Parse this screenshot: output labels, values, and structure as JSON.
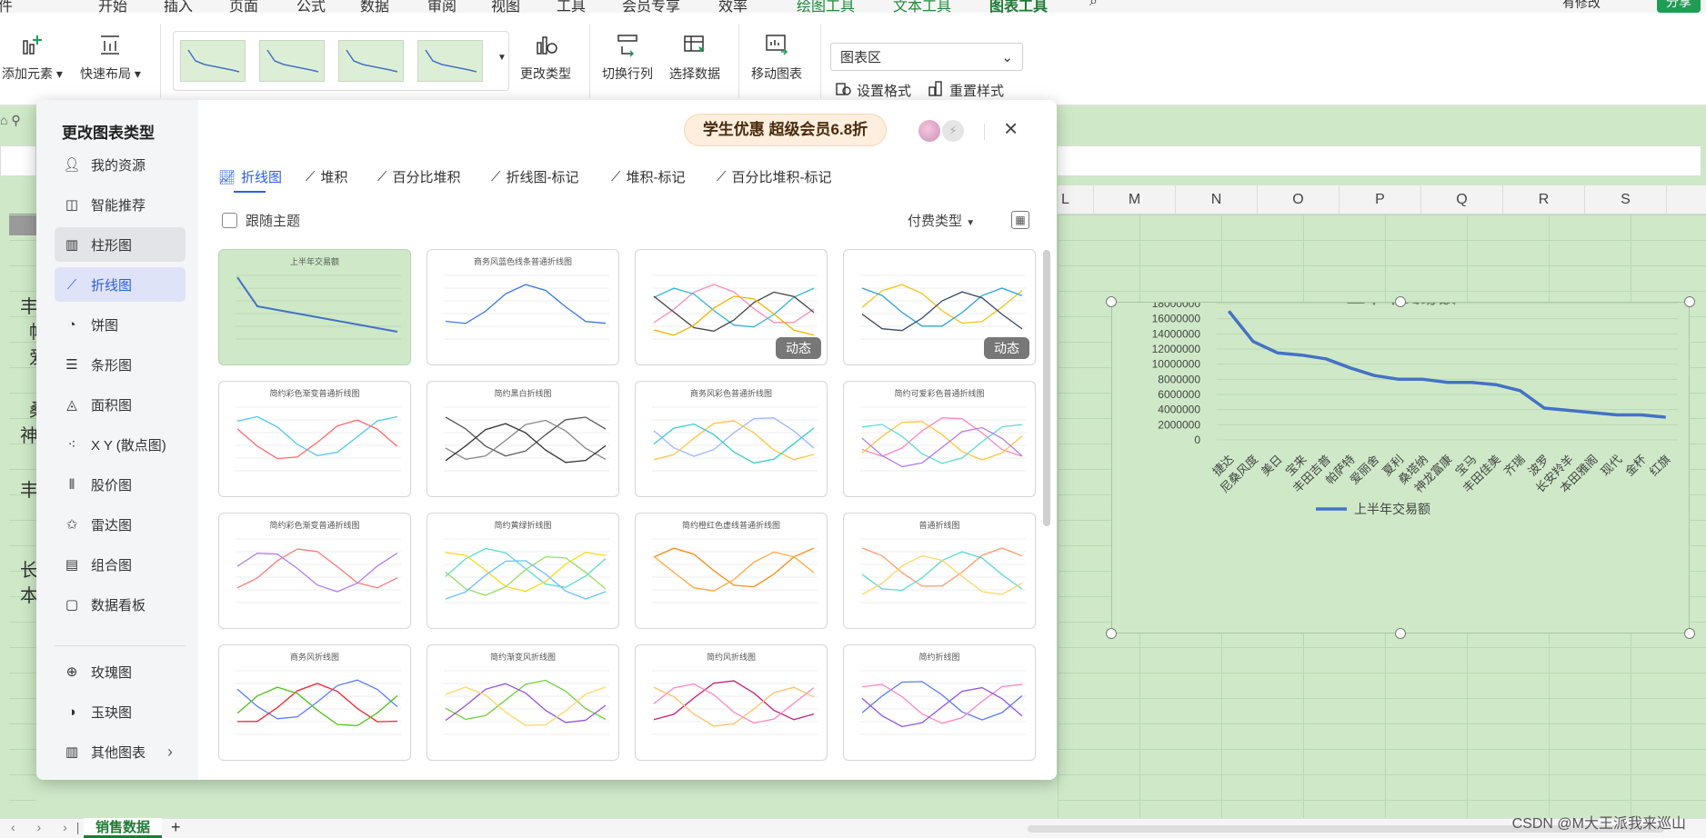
{
  "menu_tabs": [
    "文件",
    "开始",
    "插入",
    "页面",
    "公式",
    "数据",
    "审阅",
    "视图",
    "工具",
    "会员专享",
    "效率",
    "绘图工具",
    "文本工具",
    "图表工具"
  ],
  "menu_right": {
    "share": "分享",
    "privacy": "有修改"
  },
  "ribbon": {
    "add_element": "添加元素",
    "quick_layout": "快速布局",
    "change_type": "更改类型",
    "switch_row_col": "切换行列",
    "select_data": "选择数据",
    "move_chart": "移动图表",
    "area_dropdown": "图表区",
    "set_format": "设置格式",
    "reset_style": "重置样式"
  },
  "sheet": {
    "columns": [
      "L",
      "M",
      "N",
      "O",
      "P",
      "Q",
      "R",
      "S"
    ],
    "left_chars": [
      "丰",
      "帕",
      "爱",
      "桑",
      "神",
      "丰",
      "长",
      "本"
    ],
    "sheet_tab": "销售数据",
    "watermark": "CSDN @M大王派我来巡山"
  },
  "chart_data": {
    "type": "line",
    "title": "上半年交易额",
    "categories": [
      "捷达",
      "尼桑风度",
      "美日",
      "宝来",
      "丰田吉普",
      "帕萨特",
      "爱丽舍",
      "夏利",
      "桑塔纳",
      "神龙富康",
      "宝马",
      "丰田佳美",
      "齐瑞",
      "波罗",
      "长安羚羊",
      "本田雅阁",
      "现代",
      "金杯",
      "红旗"
    ],
    "series": [
      {
        "name": "上半年交易额",
        "values": [
          17000000,
          13000000,
          11500000,
          11200000,
          10700000,
          9500000,
          8500000,
          8000000,
          8000000,
          7600000,
          7600000,
          7300000,
          6500000,
          4200000,
          3900000,
          3600000,
          3300000,
          3300000,
          3000000
        ],
        "color": "#4472c4"
      }
    ],
    "ylim": [
      0,
      18000000
    ],
    "yticks": [
      0,
      2000000,
      4000000,
      6000000,
      8000000,
      10000000,
      12000000,
      14000000,
      16000000,
      18000000
    ],
    "legend": "bottom",
    "grid": true
  },
  "dialog": {
    "title": "更改图表类型",
    "promo": "学生优惠 超级会员6.8折",
    "sidebar": [
      "我的资源",
      "智能推荐",
      "柱形图",
      "折线图",
      "饼图",
      "条形图",
      "面积图",
      "X Y (散点图)",
      "股价图",
      "雷达图",
      "组合图",
      "数据看板",
      "玫瑰图",
      "玉玦图",
      "其他图表"
    ],
    "subtabs": [
      "折线图",
      "堆积",
      "百分比堆积",
      "折线图-标记",
      "堆积-标记",
      "百分比堆积-标记"
    ],
    "follow_theme": "跟随主题",
    "pay_type": "付费类型",
    "dynamic_badge": "动态",
    "cards": [
      "上半年交易额",
      "商务风蓝色线条普通折线图",
      "",
      "",
      "简约彩色渐变普通折线图",
      "简约黑白折线图",
      "商务风彩色普通折线图",
      "简约可爱彩色普通折线图",
      "简约彩色渐变普通折线图",
      "简约黄绿折线图",
      "简约橙红色虚线普通折线图",
      "普通折线图",
      "商务风折线图",
      "简约渐变风折线图",
      "简约风折线图",
      "简约折线图"
    ]
  }
}
